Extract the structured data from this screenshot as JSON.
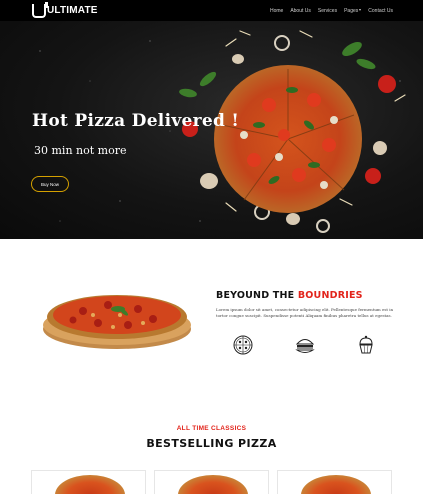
{
  "brand": {
    "name": "ULTIMATE"
  },
  "nav": {
    "links": [
      "Home",
      "About Us",
      "Services",
      "Pages",
      "Contact Us"
    ]
  },
  "hero": {
    "title": "Hot Pizza Delivered !",
    "subtitle": "30 min not more",
    "cta_label": "Buy Now"
  },
  "about": {
    "title_part1": "BEYOUND THE ",
    "title_part2": "BOUNDRIES",
    "body": "Lorem ipsum dolor sit amet, consectetur adipiscing elit. Pellentesque fermentum est in tortor congue suscipit. Suspendisse potenti Aliquam finibus pharetra tellus at egestas.",
    "features": [
      "pizza-icon",
      "burger-icon",
      "cupcake-icon"
    ]
  },
  "bestselling": {
    "eyebrow": "ALL TIME CLASSICS",
    "title": "BESTSELLING PIZZA",
    "cards": 3
  },
  "colors": {
    "accent": "#e2231a",
    "button_border": "#d4a000",
    "nav_bg": "#000000",
    "hero_bg": "#141414"
  }
}
